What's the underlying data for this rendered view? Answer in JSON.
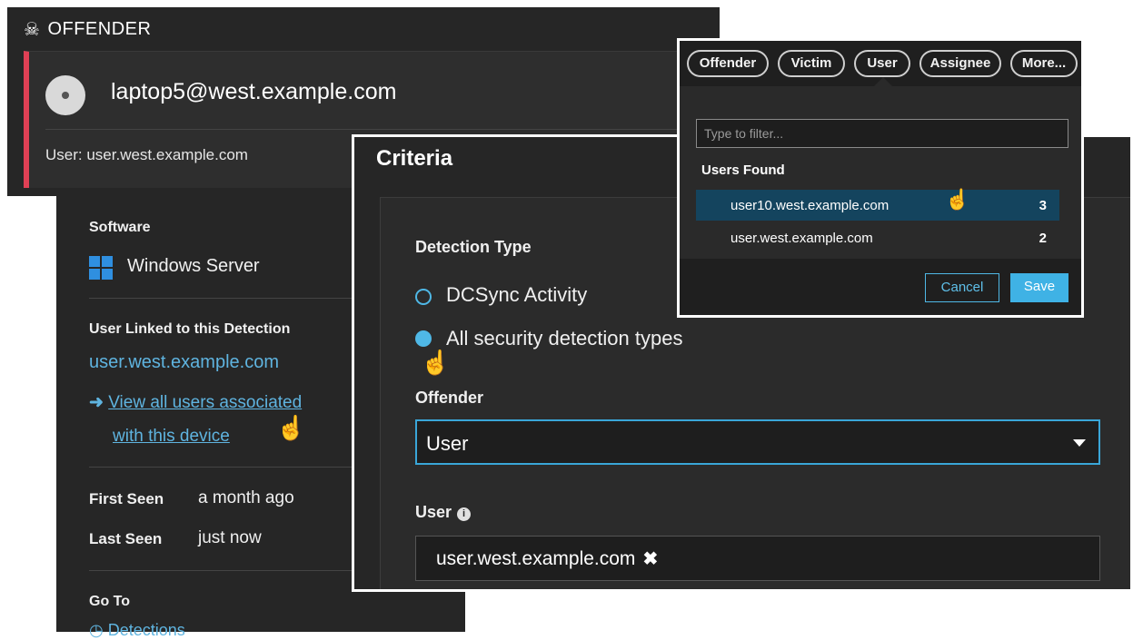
{
  "offender": {
    "header": "OFFENDER",
    "device": "laptop5@west.example.com",
    "user_line": "User: user.west.example.com"
  },
  "details": {
    "software_label": "Software",
    "software_value": "Windows Server",
    "user_linked_label": "User Linked to this Detection",
    "user_linked_value": "user.west.example.com",
    "view_all_line1": "View all users associated",
    "view_all_line2": "with this device",
    "first_seen_label": "First Seen",
    "first_seen_value": "a month ago",
    "last_seen_label": "Last Seen",
    "last_seen_value": "just now",
    "goto_label": "Go To",
    "goto_link": "Detections"
  },
  "criteria": {
    "title": "Criteria",
    "detection_type_label": "Detection Type",
    "radio_options": [
      "DCSync Activity",
      "All security detection types"
    ],
    "selected_radio": 1,
    "offender_label": "Offender",
    "offender_value": "User",
    "user_label": "User",
    "user_tag": "user.west.example.com"
  },
  "filter_popup": {
    "chips": [
      "Offender",
      "Victim",
      "User",
      "Assignee",
      "More..."
    ],
    "filter_placeholder": "Type to filter...",
    "users_found_label": "Users Found",
    "users": [
      {
        "name": "user10.west.example.com",
        "count": "3"
      },
      {
        "name": "user.west.example.com",
        "count": "2"
      }
    ],
    "cancel_label": "Cancel",
    "save_label": "Save"
  },
  "colors": {
    "accent": "#3fb2e5",
    "offender_stripe": "#e04055",
    "panel_bg": "#262626"
  },
  "icons": [
    "skull-icon",
    "device-icon",
    "windows-icon",
    "arrow-right-icon",
    "info-icon",
    "remove-tag-icon",
    "dropdown-caret-icon",
    "hand-cursor-icon"
  ]
}
